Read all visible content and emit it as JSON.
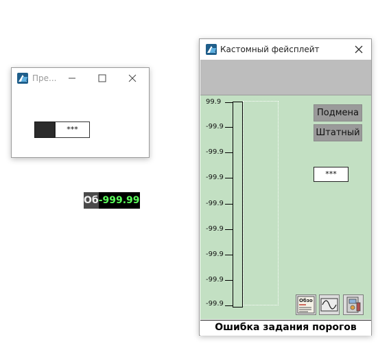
{
  "small_window": {
    "title": "Пре...",
    "field_value": "***"
  },
  "float_widget": {
    "label": "Об",
    "value": "-999.99"
  },
  "main_window": {
    "title": "Кастомный фейсплейт",
    "scale_labels": [
      "99.9",
      "-99.9",
      "-99.9",
      "-99.9",
      "-99.9",
      "-99.9",
      "-99.9",
      "-99.9"
    ],
    "scale_bottom_label": "-99.9",
    "btn_substitute": "Подмена",
    "btn_regular": "Штатный",
    "field_value": "***",
    "overview_icon_label": "Обзо",
    "status": "Ошибка задания порогов"
  },
  "icons": {
    "app": "app-logo-icon",
    "minimize": "minimize-icon",
    "maximize": "maximize-icon",
    "close": "close-icon",
    "overview": "overview-icon",
    "trend": "trend-wave-icon",
    "settings": "device-settings-icon"
  }
}
